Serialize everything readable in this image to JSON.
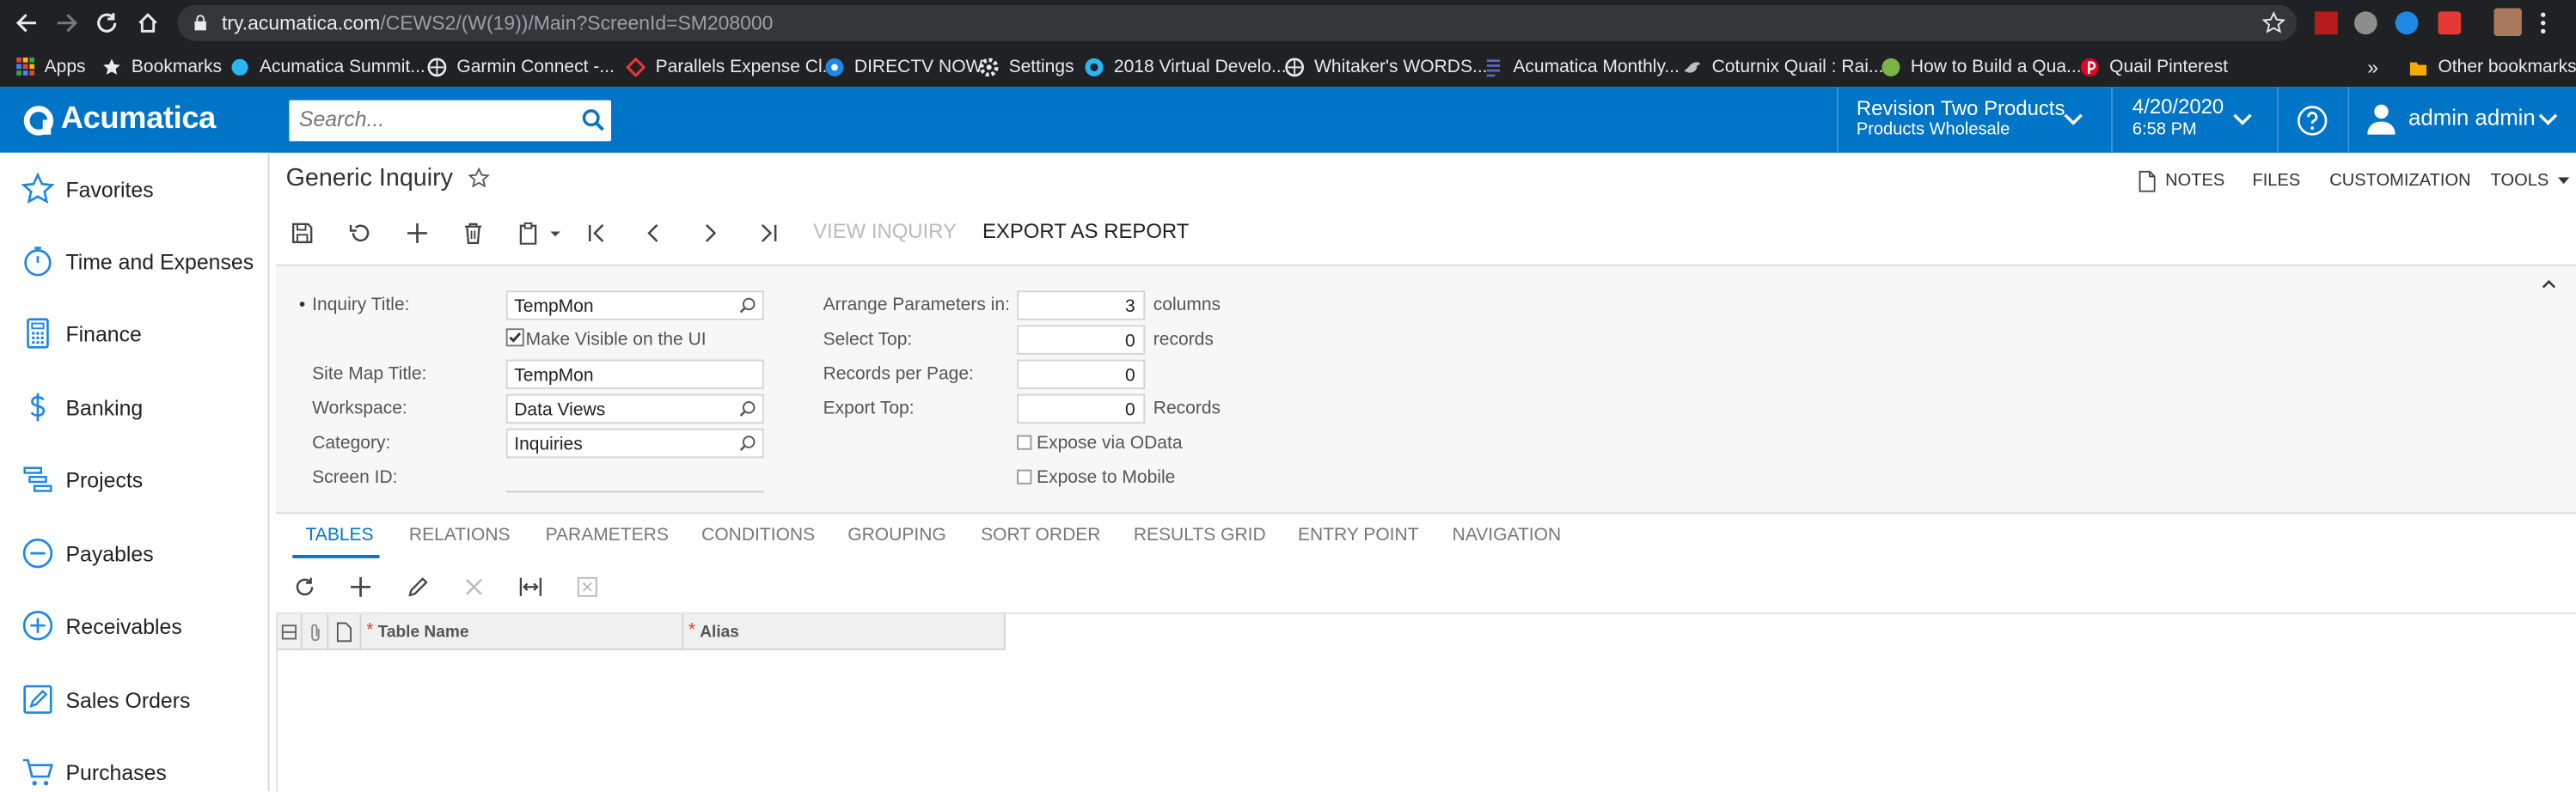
{
  "browser": {
    "url_host": "try.acumatica.com",
    "url_path": "/CEWS2/(W(19))/Main?ScreenId=SM208000",
    "bookmarks": [
      {
        "label": "Apps",
        "icon": "apps-grid-icon"
      },
      {
        "label": "Bookmarks",
        "icon": "star-icon"
      },
      {
        "label": "Acumatica Summit...",
        "icon": "acumatica-summit-icon"
      },
      {
        "label": "Garmin Connect -...",
        "icon": "globe-icon"
      },
      {
        "label": "Parallels Expense Cl...",
        "icon": "parallels-icon"
      },
      {
        "label": "DIRECTV NOW",
        "icon": "directv-icon"
      },
      {
        "label": "Settings",
        "icon": "gear-icon"
      },
      {
        "label": "2018 Virtual Develo...",
        "icon": "acumatica-icon"
      },
      {
        "label": "Whitaker's WORDS...",
        "icon": "globe-icon"
      },
      {
        "label": "Acumatica Monthly...",
        "icon": "document-icon"
      },
      {
        "label": "Coturnix Quail : Rai...",
        "icon": "bird-icon"
      },
      {
        "label": "How to Build a Qua...",
        "icon": "ssc-icon"
      },
      {
        "label": "Quail Pinterest",
        "icon": "pinterest-icon"
      }
    ],
    "overflow_label": "»",
    "other_bookmarks": "Other bookmarks"
  },
  "header": {
    "logo_text": "Acumatica",
    "search_placeholder": "Search...",
    "company": "Revision Two Products",
    "branch": "Products Wholesale",
    "date": "4/20/2020",
    "time": "6:58 PM",
    "user": "admin admin"
  },
  "sidebar": {
    "items": [
      {
        "label": "Favorites",
        "icon": "star-outline-icon"
      },
      {
        "label": "Time and Expenses",
        "icon": "stopwatch-icon"
      },
      {
        "label": "Finance",
        "icon": "calculator-icon"
      },
      {
        "label": "Banking",
        "icon": "dollar-icon"
      },
      {
        "label": "Projects",
        "icon": "projects-icon"
      },
      {
        "label": "Payables",
        "icon": "minus-circle-icon"
      },
      {
        "label": "Receivables",
        "icon": "plus-circle-icon"
      },
      {
        "label": "Sales Orders",
        "icon": "pencil-square-icon"
      },
      {
        "label": "Purchases",
        "icon": "cart-icon"
      }
    ]
  },
  "page": {
    "title": "Generic Inquiry",
    "actions": {
      "notes": "NOTES",
      "files": "FILES",
      "customization": "CUSTOMIZATION",
      "tools": "TOOLS"
    },
    "toolbar": {
      "view_inquiry": "VIEW INQUIRY",
      "export_as_report": "EXPORT AS REPORT"
    }
  },
  "form": {
    "inquiry_title_label": "Inquiry Title:",
    "inquiry_title_value": "TempMon",
    "make_visible_label": "Make Visible on the UI",
    "make_visible_checked": true,
    "site_map_title_label": "Site Map Title:",
    "site_map_title_value": "TempMon",
    "workspace_label": "Workspace:",
    "workspace_value": "Data Views",
    "category_label": "Category:",
    "category_value": "Inquiries",
    "screen_id_label": "Screen ID:",
    "screen_id_value": "",
    "arrange_label": "Arrange Parameters in:",
    "arrange_value": "3",
    "arrange_unit": "columns",
    "select_top_label": "Select Top:",
    "select_top_value": "0",
    "select_top_unit": "records",
    "rpp_label": "Records per Page:",
    "rpp_value": "0",
    "export_top_label": "Export Top:",
    "export_top_value": "0",
    "export_top_unit": "Records",
    "odata_label": "Expose via OData",
    "odata_checked": false,
    "mobile_label": "Expose to Mobile",
    "mobile_checked": false
  },
  "tabs": [
    "TABLES",
    "RELATIONS",
    "PARAMETERS",
    "CONDITIONS",
    "GROUPING",
    "SORT ORDER",
    "RESULTS GRID",
    "ENTRY POINT",
    "NAVIGATION"
  ],
  "active_tab": "TABLES",
  "grid": {
    "columns": [
      "Table Name",
      "Alias"
    ],
    "required_marker": "*"
  },
  "colors": {
    "brand": "#0074c7",
    "active_tab": "#0074c7",
    "required": "#e53935"
  }
}
